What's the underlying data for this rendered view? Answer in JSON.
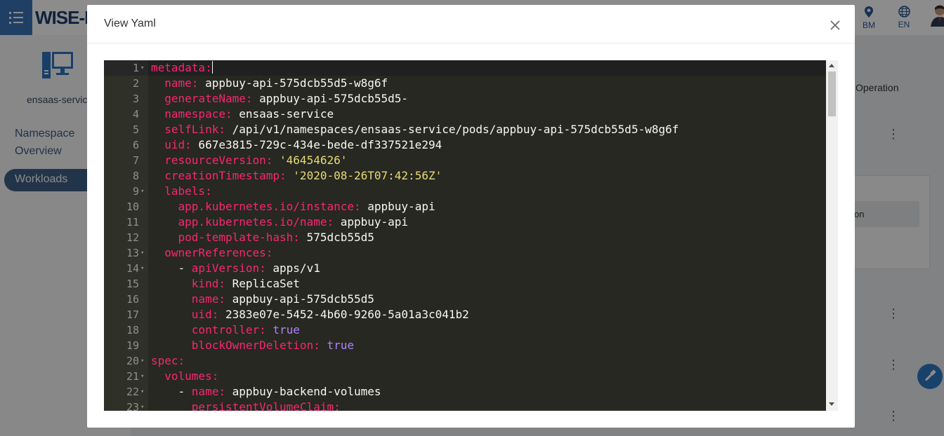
{
  "app": {
    "brand": "WISE-P",
    "top_items": [
      {
        "icon": "location-pin-icon",
        "label": "BM"
      },
      {
        "icon": "globe-icon",
        "label": "EN"
      }
    ],
    "colors": {
      "accent": "#3b73b9",
      "nav_active": "#3f5f86",
      "fab": "#2f78c4"
    }
  },
  "sidebar": {
    "service_name": "ensaas-service",
    "nav_namespace": "Namespace Overview",
    "nav_workloads": "Workloads"
  },
  "background": {
    "operation_header": "Operation",
    "panel_header_text": "on"
  },
  "modal": {
    "title": "View Yaml",
    "close_icon": "close-icon"
  },
  "editor": {
    "theme": "monokai",
    "colors": {
      "background": "#272822",
      "key": "#f92672",
      "string": "#e6db74",
      "boolean": "#ae81ff",
      "text": "#f8f8f2"
    },
    "lines": [
      {
        "n": "1",
        "fold": true,
        "parts": [
          {
            "t": "metadata:",
            "c": "k"
          }
        ]
      },
      {
        "n": "2",
        "parts": [
          {
            "t": "  "
          },
          {
            "t": "name:",
            "c": "k"
          },
          {
            "t": " appbuy-api-575dcb55d5-w8g6f"
          }
        ]
      },
      {
        "n": "3",
        "parts": [
          {
            "t": "  "
          },
          {
            "t": "generateName:",
            "c": "k"
          },
          {
            "t": " appbuy-api-575dcb55d5-"
          }
        ]
      },
      {
        "n": "4",
        "parts": [
          {
            "t": "  "
          },
          {
            "t": "namespace:",
            "c": "k"
          },
          {
            "t": " ensaas-service"
          }
        ]
      },
      {
        "n": "5",
        "parts": [
          {
            "t": "  "
          },
          {
            "t": "selfLink:",
            "c": "k"
          },
          {
            "t": " /api/v1/namespaces/ensaas-service/pods/appbuy-api-575dcb55d5-w8g6f"
          }
        ]
      },
      {
        "n": "6",
        "parts": [
          {
            "t": "  "
          },
          {
            "t": "uid:",
            "c": "k"
          },
          {
            "t": " 667e3815-729c-434e-bede-df337521e294"
          }
        ]
      },
      {
        "n": "7",
        "parts": [
          {
            "t": "  "
          },
          {
            "t": "resourceVersion:",
            "c": "k"
          },
          {
            "t": " "
          },
          {
            "t": "'46454626'",
            "c": "s"
          }
        ]
      },
      {
        "n": "8",
        "parts": [
          {
            "t": "  "
          },
          {
            "t": "creationTimestamp:",
            "c": "k"
          },
          {
            "t": " "
          },
          {
            "t": "'2020-08-26T07:42:56Z'",
            "c": "s"
          }
        ]
      },
      {
        "n": "9",
        "fold": true,
        "parts": [
          {
            "t": "  "
          },
          {
            "t": "labels:",
            "c": "k"
          }
        ]
      },
      {
        "n": "10",
        "parts": [
          {
            "t": "    "
          },
          {
            "t": "app.kubernetes.io/instance:",
            "c": "k"
          },
          {
            "t": " appbuy-api"
          }
        ]
      },
      {
        "n": "11",
        "parts": [
          {
            "t": "    "
          },
          {
            "t": "app.kubernetes.io/name:",
            "c": "k"
          },
          {
            "t": " appbuy-api"
          }
        ]
      },
      {
        "n": "12",
        "parts": [
          {
            "t": "    "
          },
          {
            "t": "pod-template-hash:",
            "c": "k"
          },
          {
            "t": " 575dcb55d5"
          }
        ]
      },
      {
        "n": "13",
        "fold": true,
        "parts": [
          {
            "t": "  "
          },
          {
            "t": "ownerReferences:",
            "c": "k"
          }
        ]
      },
      {
        "n": "14",
        "fold": true,
        "parts": [
          {
            "t": "    - "
          },
          {
            "t": "apiVersion:",
            "c": "k"
          },
          {
            "t": " apps/v1"
          }
        ]
      },
      {
        "n": "15",
        "parts": [
          {
            "t": "      "
          },
          {
            "t": "kind:",
            "c": "k"
          },
          {
            "t": " ReplicaSet"
          }
        ]
      },
      {
        "n": "16",
        "parts": [
          {
            "t": "      "
          },
          {
            "t": "name:",
            "c": "k"
          },
          {
            "t": " appbuy-api-575dcb55d5"
          }
        ]
      },
      {
        "n": "17",
        "parts": [
          {
            "t": "      "
          },
          {
            "t": "uid:",
            "c": "k"
          },
          {
            "t": " 2383e07e-5452-4b60-9260-5a01a3c041b2"
          }
        ]
      },
      {
        "n": "18",
        "parts": [
          {
            "t": "      "
          },
          {
            "t": "controller:",
            "c": "k"
          },
          {
            "t": " "
          },
          {
            "t": "true",
            "c": "b"
          }
        ]
      },
      {
        "n": "19",
        "parts": [
          {
            "t": "      "
          },
          {
            "t": "blockOwnerDeletion:",
            "c": "k"
          },
          {
            "t": " "
          },
          {
            "t": "true",
            "c": "b"
          }
        ]
      },
      {
        "n": "20",
        "fold": true,
        "parts": [
          {
            "t": "spec:",
            "c": "k"
          }
        ]
      },
      {
        "n": "21",
        "fold": true,
        "parts": [
          {
            "t": "  "
          },
          {
            "t": "volumes:",
            "c": "k"
          }
        ]
      },
      {
        "n": "22",
        "fold": true,
        "parts": [
          {
            "t": "    - "
          },
          {
            "t": "name:",
            "c": "k"
          },
          {
            "t": " appbuy-backend-volumes"
          }
        ]
      },
      {
        "n": "23",
        "fold": true,
        "parts": [
          {
            "t": "      "
          },
          {
            "t": "persistentVolumeClaim:",
            "c": "k"
          }
        ]
      }
    ]
  }
}
